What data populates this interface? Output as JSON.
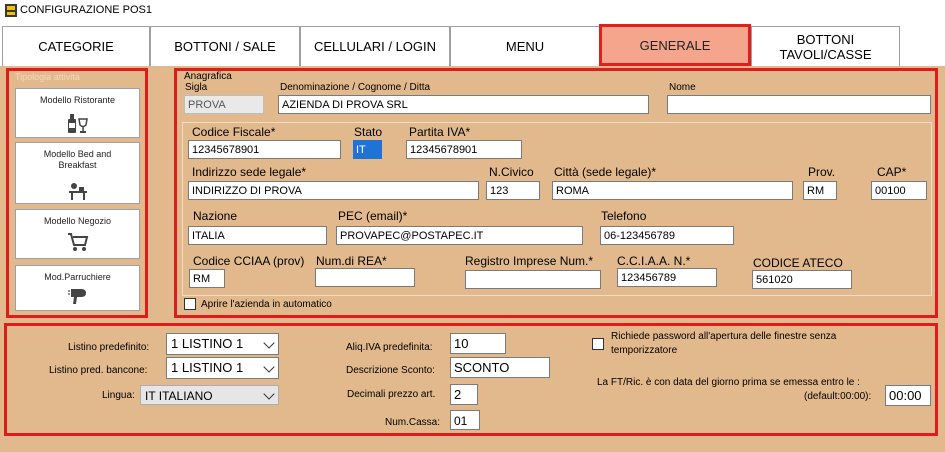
{
  "window": {
    "title": "CONFIGURAZIONE POS1",
    "icon": "app-icon"
  },
  "tabs": [
    {
      "label": "CATEGORIE"
    },
    {
      "label": "BOTTONI / SALE"
    },
    {
      "label": "CELLULARI / LOGIN"
    },
    {
      "label": "MENU"
    },
    {
      "label": "GENERALE",
      "active": true
    },
    {
      "label_line1": "BOTTONI",
      "label_line2": "TAVOLI/CASSE"
    }
  ],
  "tipologia": {
    "legend": "Tipologia attività",
    "models": [
      {
        "label": "Modello Ristorante",
        "icon": "restaurant-bottle-glass-icon"
      },
      {
        "label_line1": "Modello Bed and",
        "label_line2": "Breakfast",
        "icon": "bed-breakfast-table-icon"
      },
      {
        "label": "Modello Negozio",
        "icon": "shopping-cart-icon"
      },
      {
        "label": "Mod.Parruchiere",
        "icon": "hair-dryer-icon"
      }
    ]
  },
  "anagrafica": {
    "legend": "Anagrafica",
    "sigla": {
      "label": "Sigla",
      "value": "PROVA"
    },
    "denominazione": {
      "label": "Denominazione / Cognome / Ditta",
      "value": "AZIENDA DI PROVA SRL"
    },
    "nome": {
      "label": "Nome",
      "value": ""
    },
    "codice_fiscale": {
      "label": "Codice Fiscale*",
      "value": "12345678901"
    },
    "stato": {
      "label": "Stato",
      "value": "IT"
    },
    "partita_iva": {
      "label": "Partita IVA*",
      "value": "12345678901"
    },
    "indirizzo": {
      "label": "Indirizzo sede legale*",
      "value": "INDIRIZZO DI PROVA"
    },
    "civico": {
      "label": "N.Civico",
      "value": "123"
    },
    "citta": {
      "label": "Città  (sede legale)*",
      "value": "ROMA"
    },
    "prov": {
      "label": "Prov.",
      "value": "RM"
    },
    "cap": {
      "label": "CAP*",
      "value": "00100"
    },
    "nazione": {
      "label": "Nazione",
      "value": "ITALIA"
    },
    "pec": {
      "label": "PEC (email)*",
      "value": "PROVAPEC@POSTAPEC.IT"
    },
    "telefono": {
      "label": "Telefono",
      "value": "06-123456789"
    },
    "codice_cciaa": {
      "label": "Codice CCIAA (prov)",
      "value": "RM"
    },
    "num_rea": {
      "label": "Num.di REA*",
      "value": ""
    },
    "registro_imprese": {
      "label": "Registro Imprese Num.*",
      "value": ""
    },
    "cciaa_n": {
      "label": "C.C.I.A.A. N.*",
      "value": "123456789"
    },
    "codice_ateco": {
      "label": "CODICE ATECO",
      "value": "561020"
    },
    "aprire_auto": {
      "label": "Aprire l'azienda in automatico",
      "checked": false
    }
  },
  "settings": {
    "listino_predefinito": {
      "label": "Listino predefinito:",
      "value": "1 LISTINO 1"
    },
    "listino_bancone": {
      "label": "Listino pred. bancone:",
      "value": "1 LISTINO 1"
    },
    "lingua": {
      "label": "Lingua:",
      "value": "IT ITALIANO"
    },
    "aliq_iva": {
      "label": "Aliq.IVA predefinita:",
      "value": "10"
    },
    "descrizione_sconto": {
      "label": "Descrizione Sconto:",
      "value": "SCONTO"
    },
    "decimali_prezzo": {
      "label": "Decimali prezzo art.",
      "value": "2"
    },
    "num_cassa": {
      "label": "Num.Cassa:",
      "value": "01"
    },
    "password_richiesta": {
      "label_line1": "Richiede password all'apertura delle finestre senza",
      "label_line2": "temporizzatore",
      "checked": false
    },
    "ft_ric": {
      "label_line1": "La FT/Ric. è con data del giorno prima se emessa entro le :",
      "label_line2": "(default:00:00):",
      "value": "00:00"
    }
  },
  "colors": {
    "panel": "#e2b98c",
    "highlight_border": "#e01b1b",
    "active_tab": "#f4a58c",
    "selection": "#1e73d4"
  }
}
